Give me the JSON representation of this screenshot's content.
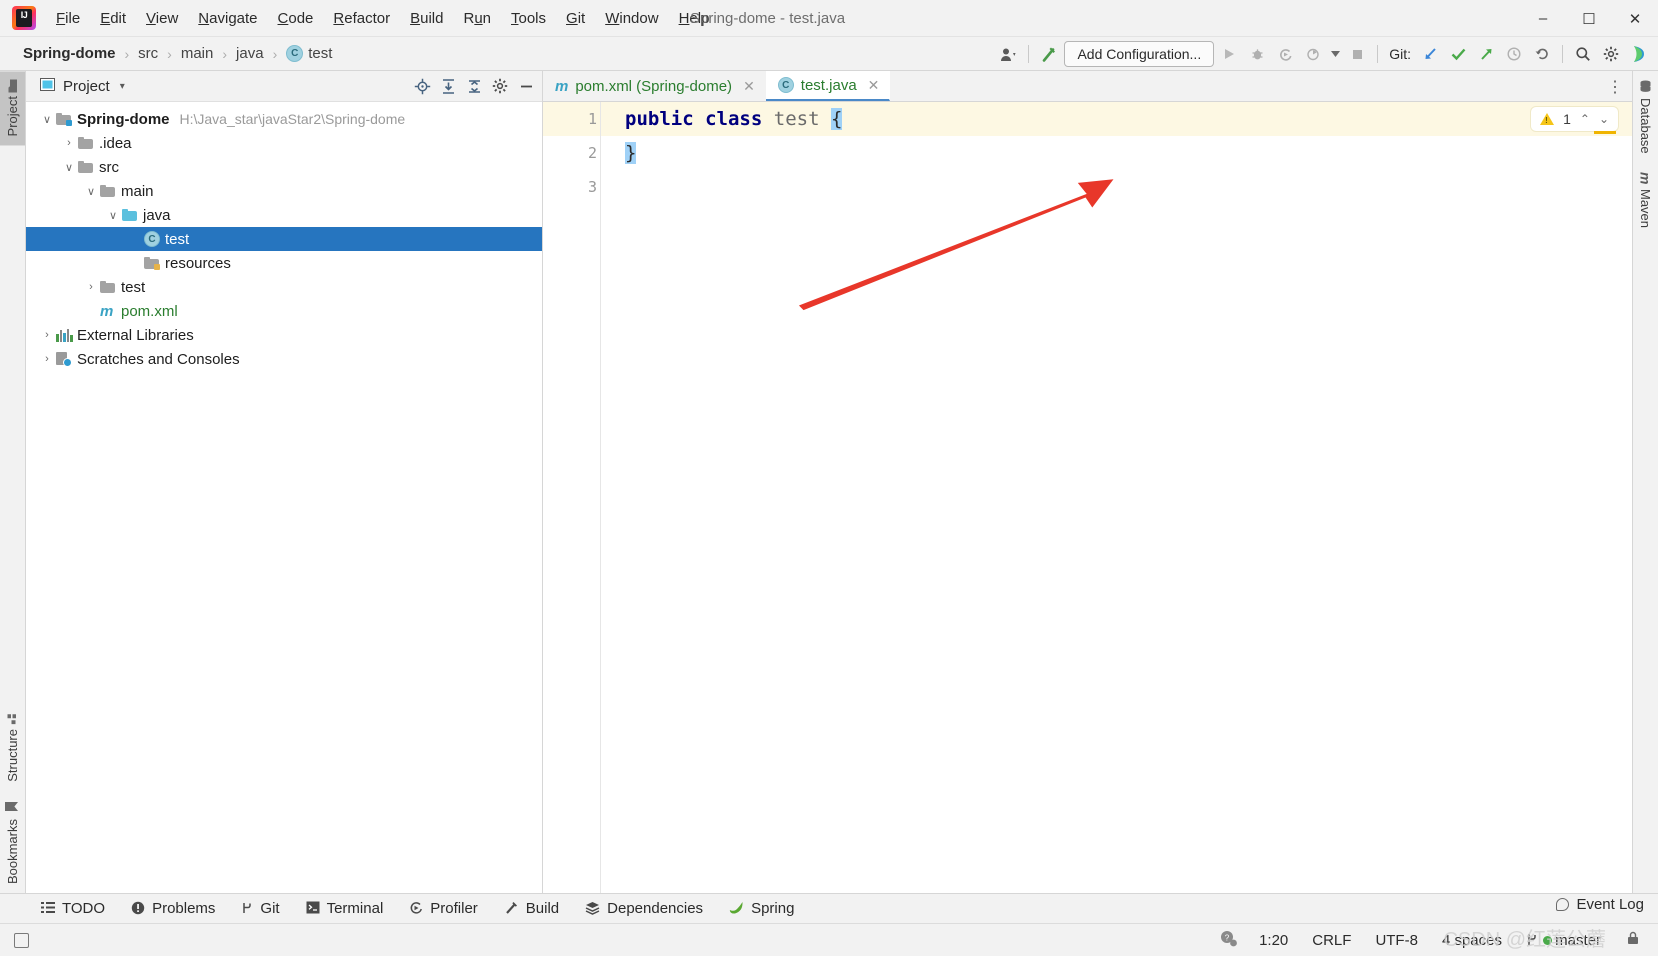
{
  "window": {
    "title": "Spring-dome - test.java",
    "minimize": "–",
    "maximize": "☐",
    "close": "✕",
    "logo_text": "IJ"
  },
  "menu": {
    "items": [
      {
        "label": "File",
        "mnemonic": "F"
      },
      {
        "label": "Edit",
        "mnemonic": "E"
      },
      {
        "label": "View",
        "mnemonic": "V"
      },
      {
        "label": "Navigate",
        "mnemonic": "N"
      },
      {
        "label": "Code",
        "mnemonic": "C"
      },
      {
        "label": "Refactor",
        "mnemonic": "R"
      },
      {
        "label": "Build",
        "mnemonic": "B"
      },
      {
        "label": "Run",
        "mnemonic": "u"
      },
      {
        "label": "Tools",
        "mnemonic": "T"
      },
      {
        "label": "Git",
        "mnemonic": "G"
      },
      {
        "label": "Window",
        "mnemonic": "W"
      },
      {
        "label": "Help",
        "mnemonic": "H"
      }
    ]
  },
  "breadcrumb": {
    "separator": "›",
    "segments": [
      "Spring-dome",
      "src",
      "main",
      "java",
      "test"
    ],
    "class_badge": "C"
  },
  "toolbar": {
    "add_configuration": "Add Configuration...",
    "git_label": "Git:",
    "icons": [
      "user-avatar-icon",
      "build-hammer-icon",
      "run-icon",
      "debug-icon",
      "run-with-coverage-icon",
      "profile-icon",
      "stop-icon",
      "git-update-icon",
      "git-commit-icon",
      "git-push-icon",
      "git-history-icon",
      "git-rollback-icon",
      "search-everywhere-icon",
      "settings-gear-icon",
      "ide-assistant-icon"
    ]
  },
  "left_stripe": {
    "top": [
      {
        "label": "Project",
        "icon": "project-icon",
        "active": true
      }
    ],
    "bottom": [
      {
        "label": "Structure",
        "icon": "structure-icon",
        "active": false
      },
      {
        "label": "Bookmarks",
        "icon": "bookmark-icon",
        "active": false
      }
    ]
  },
  "right_stripe": {
    "items": [
      {
        "label": "Database",
        "icon": "database-icon"
      },
      {
        "label": "Maven",
        "icon": "maven-icon"
      }
    ]
  },
  "project_panel": {
    "title": "Project",
    "caret": "▾",
    "header_icons": [
      "locate-icon",
      "expand-all-icon",
      "collapse-all-icon",
      "settings-gear-icon",
      "hide-icon"
    ],
    "tree": [
      {
        "label": "Spring-dome",
        "path": "H:\\Java_star\\javaStar2\\Spring-dome",
        "indent": 0,
        "arrow": "∨",
        "icon": "module-folder-icon",
        "bold": true,
        "selected": false
      },
      {
        "label": ".idea",
        "path": "",
        "indent": 1,
        "arrow": "›",
        "icon": "folder-icon",
        "bold": false,
        "selected": false
      },
      {
        "label": "src",
        "path": "",
        "indent": 1,
        "arrow": "∨",
        "icon": "folder-icon",
        "bold": false,
        "selected": false
      },
      {
        "label": "main",
        "path": "",
        "indent": 2,
        "arrow": "∨",
        "icon": "folder-icon",
        "bold": false,
        "selected": false
      },
      {
        "label": "java",
        "path": "",
        "indent": 3,
        "arrow": "∨",
        "icon": "source-folder-icon",
        "bold": false,
        "selected": false
      },
      {
        "label": "test",
        "path": "",
        "indent": 4,
        "arrow": "",
        "icon": "java-class-icon",
        "bold": false,
        "selected": true
      },
      {
        "label": "resources",
        "path": "",
        "indent": 4,
        "arrow": "",
        "icon": "resources-folder-icon",
        "bold": false,
        "selected": false
      },
      {
        "label": "test",
        "path": "",
        "indent": 2,
        "arrow": "›",
        "icon": "folder-icon",
        "bold": false,
        "selected": false
      },
      {
        "label": "pom.xml",
        "path": "",
        "indent": 2,
        "arrow": "",
        "icon": "maven-pom-icon",
        "bold": false,
        "selected": false
      },
      {
        "label": "External Libraries",
        "path": "",
        "indent": 0,
        "arrow": "›",
        "icon": "libraries-icon",
        "bold": false,
        "selected": false
      },
      {
        "label": "Scratches and Consoles",
        "path": "",
        "indent": 0,
        "arrow": "›",
        "icon": "scratches-icon",
        "bold": false,
        "selected": false
      }
    ]
  },
  "editor": {
    "tabs": [
      {
        "label": "pom.xml (Spring-dome)",
        "icon": "maven-pom-icon",
        "active": false,
        "close": "✕"
      },
      {
        "label": "test.java",
        "icon": "java-class-icon",
        "active": true,
        "close": "✕"
      }
    ],
    "more_icon": "⋮",
    "gutter_lines": [
      "1",
      "2",
      "3"
    ],
    "code_lines": [
      {
        "number": "1",
        "tokens": [
          {
            "text": "public",
            "type": "keyword"
          },
          {
            "text": " ",
            "type": "plain"
          },
          {
            "text": "class",
            "type": "keyword"
          },
          {
            "text": " ",
            "type": "plain"
          },
          {
            "text": "test",
            "type": "identifier"
          },
          {
            "text": " ",
            "type": "plain"
          },
          {
            "text": "{",
            "type": "brace-highlight"
          }
        ]
      },
      {
        "number": "2",
        "tokens": [
          {
            "text": "}",
            "type": "brace-highlight"
          }
        ]
      },
      {
        "number": "3",
        "tokens": []
      }
    ],
    "inspection": {
      "warning_count": "1",
      "icon": "warning-triangle-icon",
      "prev": "⌃",
      "next": "⌄"
    }
  },
  "bottom_tools": [
    {
      "label": "TODO",
      "icon": "todo-icon"
    },
    {
      "label": "Problems",
      "icon": "problems-icon"
    },
    {
      "label": "Git",
      "icon": "git-branch-icon"
    },
    {
      "label": "Terminal",
      "icon": "terminal-icon"
    },
    {
      "label": "Profiler",
      "icon": "profiler-icon"
    },
    {
      "label": "Build",
      "icon": "build-hammer-icon"
    },
    {
      "label": "Dependencies",
      "icon": "dependencies-icon"
    },
    {
      "label": "Spring",
      "icon": "spring-leaf-icon"
    }
  ],
  "status_bar": {
    "event_log": "Event Log",
    "event_log_icon": "event-log-icon",
    "help_icon": "help-icon",
    "caret_position": "1:20",
    "line_separator": "CRLF",
    "encoding": "UTF-8",
    "indent": "4 spaces",
    "branch": "master",
    "branch_icon": "git-branch-icon",
    "lock_icon": "read-only-lock-icon",
    "watermark": "CSDN @红莲公蘑"
  },
  "colors": {
    "selection_blue": "#2675bf",
    "accent_tab": "#4a89c8",
    "warning_yellow": "#f5c518",
    "caret_line": "#fdf8e3",
    "arrow_red": "#e8372a",
    "green_text": "#2a7d2e",
    "keyword_blue": "#00007f"
  }
}
